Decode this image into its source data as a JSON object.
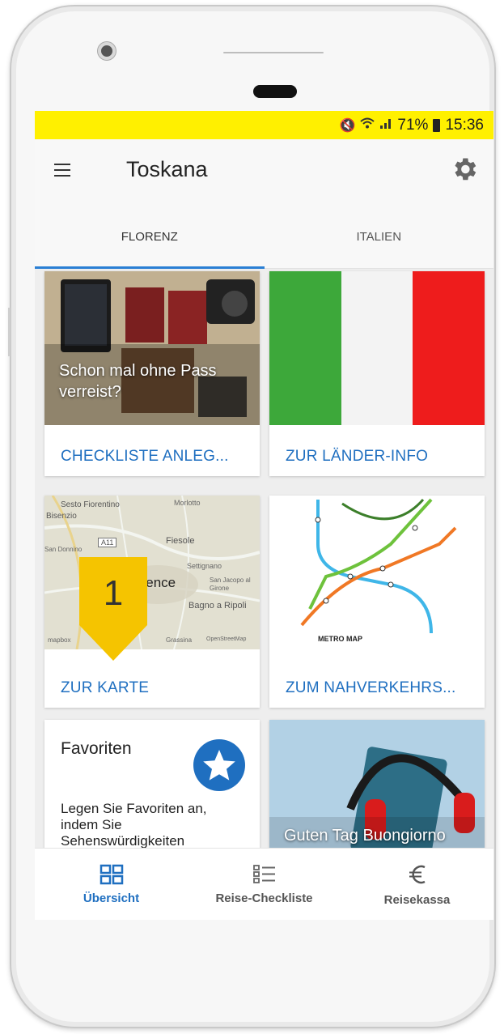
{
  "status_bar": {
    "battery": "71%",
    "time": "15:36",
    "background": "#fff000"
  },
  "app_bar": {
    "title": "Toskana"
  },
  "tabs": [
    {
      "label": "FLORENZ",
      "active": true
    },
    {
      "label": "ITALIEN",
      "active": false
    }
  ],
  "cards": {
    "checklist": {
      "overlay": "Schon mal ohne Pass verreist?",
      "action": "CHECKLISTE ANLEG..."
    },
    "country": {
      "action": "ZUR LÄNDER-INFO"
    },
    "map": {
      "action": "ZUR KARTE",
      "places": [
        "Sesto Fiorentino",
        "Bisenzio",
        "Morlotto",
        "A11",
        "Fiesole",
        "San Donnino",
        "Settignano",
        "Florence",
        "San Jacopo al Girone",
        "Bagno a Ripoli",
        "mapbox",
        "Grassina",
        "OpenStreetMap"
      ]
    },
    "transit": {
      "action": "ZUM NAHVERKEHRS...",
      "map_title": "METRO MAP"
    },
    "favorites": {
      "title": "Favoriten",
      "body": "Legen Sie Favoriten an, indem Sie Sehenswürdigkeiten"
    },
    "language": {
      "overlay": "Guten Tag Buongiorno"
    }
  },
  "bottom_nav": [
    {
      "label": "Übersicht",
      "icon": "grid-icon",
      "active": true
    },
    {
      "label": "Reise-Checkliste",
      "icon": "checklist-icon",
      "active": false
    },
    {
      "label": "Reisekassa",
      "icon": "euro-icon",
      "active": false
    }
  ],
  "marker": {
    "number": "1",
    "color": "#f5c400"
  },
  "colors": {
    "accent": "#1f6fc0",
    "tab_indicator": "#2a7fd4",
    "flag_green": "#3da83a",
    "flag_red": "#ee1c1c"
  }
}
